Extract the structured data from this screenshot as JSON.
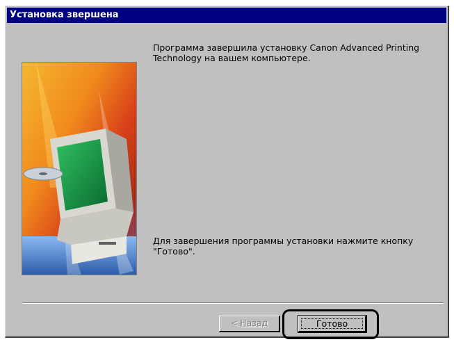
{
  "window": {
    "title": "Установка звершена"
  },
  "message": {
    "completed": "Программа завершила установку Canon Advanced Printing\nTechnology  на вашем компьютере.",
    "instruction": "Для завершения программы установки нажмите кнопку\n\"Готово\"."
  },
  "buttons": {
    "back_arrow": "<",
    "back_label": "Назад",
    "finish_label": "Готово"
  },
  "illustration": {
    "icon": "computer-with-cd-icon",
    "colors": {
      "background_top": "#f2a01a",
      "background_mid": "#e0401a",
      "monitor_screen": "#108a40",
      "floor": "#5a8fd8"
    }
  }
}
